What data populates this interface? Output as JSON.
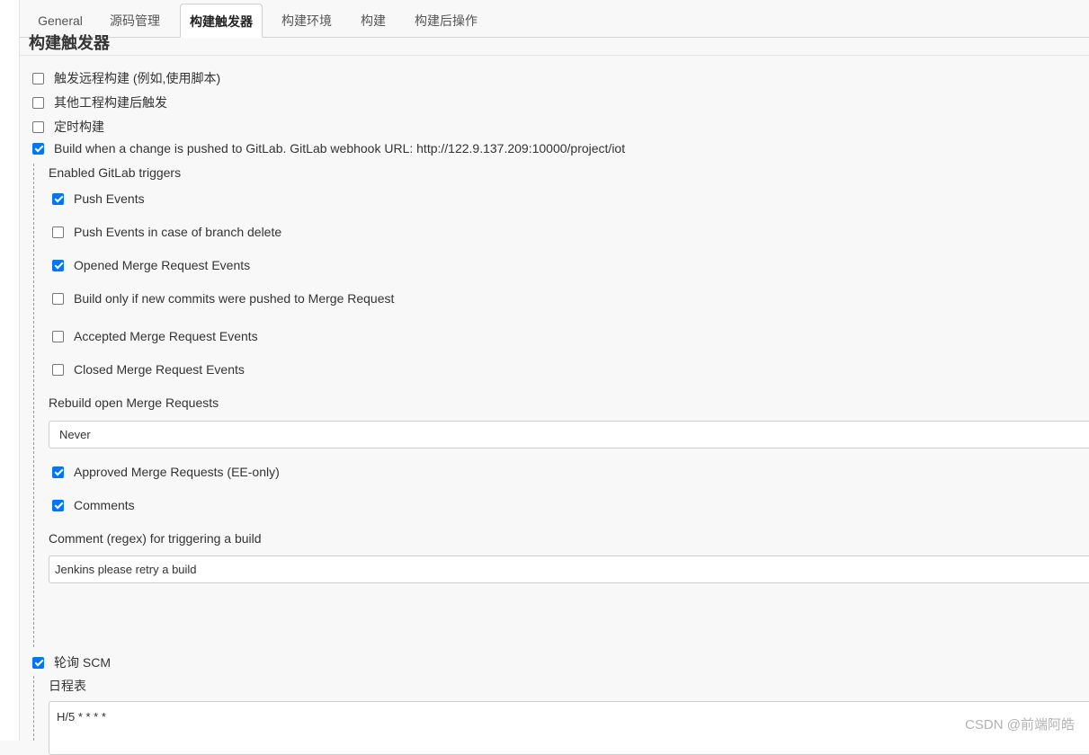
{
  "tabs": [
    {
      "label": "General"
    },
    {
      "label": "源码管理"
    },
    {
      "label": "构建触发器",
      "active": true
    },
    {
      "label": "构建环境"
    },
    {
      "label": "构建"
    },
    {
      "label": "构建后操作"
    }
  ],
  "section": {
    "title": "构建触发器"
  },
  "triggers": {
    "remote": {
      "label": "触发远程构建 (例如,使用脚本)",
      "checked": false
    },
    "after_other": {
      "label": "其他工程构建后触发",
      "checked": false
    },
    "periodic": {
      "label": "定时构建",
      "checked": false
    },
    "gitlab": {
      "label": "Build when a change is pushed to GitLab. GitLab webhook URL: http://122.9.137.209:10000/project/iot",
      "checked": true
    },
    "poll_scm": {
      "label": "轮询 SCM",
      "checked": true
    }
  },
  "gitlab": {
    "enabled_triggers_label": "Enabled GitLab triggers",
    "push_events": {
      "label": "Push Events",
      "checked": true
    },
    "push_branch_delete": {
      "label": "Push Events in case of branch delete",
      "checked": false
    },
    "opened_mr": {
      "label": "Opened Merge Request Events",
      "checked": true
    },
    "build_only_new_commits": {
      "label": "Build only if new commits were pushed to Merge Request",
      "checked": false
    },
    "accepted_mr": {
      "label": "Accepted Merge Request Events",
      "checked": false
    },
    "closed_mr": {
      "label": "Closed Merge Request Events",
      "checked": false
    },
    "rebuild_label": "Rebuild open Merge Requests",
    "rebuild_value": "Never",
    "approved_mr": {
      "label": "Approved Merge Requests (EE-only)",
      "checked": true
    },
    "comments": {
      "label": "Comments",
      "checked": true
    },
    "comment_regex_label": "Comment (regex) for triggering a build",
    "comment_regex_value": "Jenkins please retry a build"
  },
  "scm": {
    "schedule_label": "日程表",
    "schedule_value": "H/5 * * * *"
  },
  "watermark": "CSDN @前端阿皓",
  "colors": {
    "checkbox_checked": "#0075ff",
    "background": "#f8f8f8"
  }
}
